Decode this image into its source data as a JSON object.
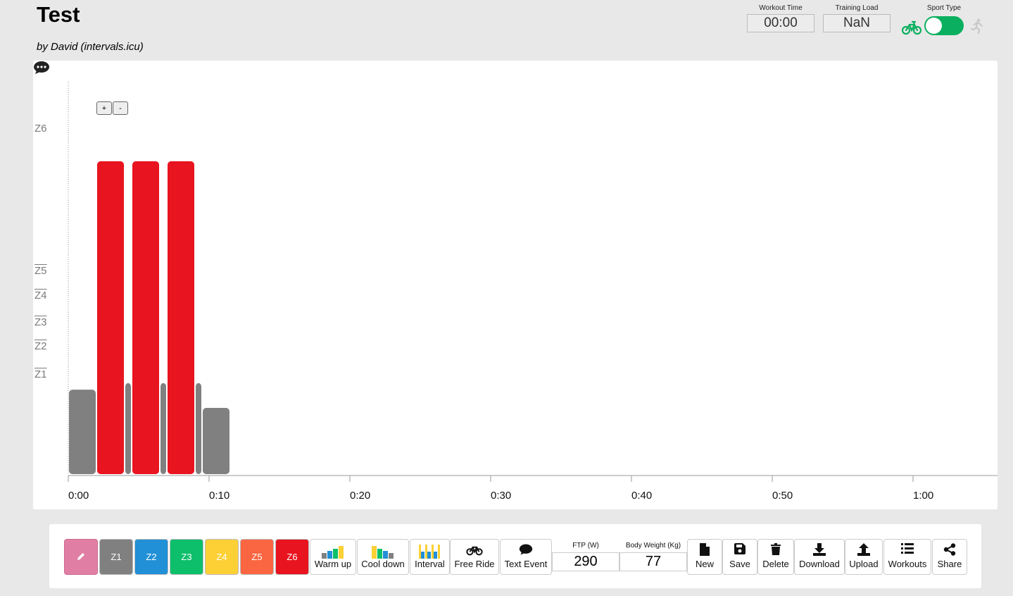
{
  "workout": {
    "title": "Test",
    "author": "by David (intervals.icu)"
  },
  "stats": {
    "workout_time_label": "Workout Time",
    "workout_time_value": "00:00",
    "training_load_label": "Training Load",
    "training_load_value": "NaN",
    "sport_type_label": "Sport Type",
    "sport_selected": "bike"
  },
  "chart": {
    "zoom_in_label": "+",
    "zoom_out_label": "-",
    "zone_labels": [
      "Z6",
      "Z5",
      "Z4",
      "Z3",
      "Z2",
      "Z1"
    ],
    "time_ticks": [
      "0:00",
      "0:10",
      "0:20",
      "0:30",
      "0:40",
      "0:50",
      "1:00"
    ]
  },
  "chart_data": {
    "type": "bar",
    "xlabel": "",
    "ylabel": "",
    "x_ticks": [
      "0:00",
      "0:10",
      "0:20",
      "0:30",
      "0:40",
      "0:50",
      "1:00"
    ],
    "x_range_minutes": [
      0,
      66
    ],
    "intervals": [
      {
        "start_min": 0.0,
        "end_min": 2.0,
        "zone": "Z1",
        "power_pct_ftp": 51,
        "color": "#808080"
      },
      {
        "start_min": 2.0,
        "end_min": 4.0,
        "zone": "Z6",
        "power_pct_ftp": 189,
        "color": "#e8141f"
      },
      {
        "start_min": 4.0,
        "end_min": 4.5,
        "zone": "Z1",
        "power_pct_ftp": 55,
        "color": "#808080"
      },
      {
        "start_min": 4.5,
        "end_min": 6.5,
        "zone": "Z6",
        "power_pct_ftp": 189,
        "color": "#e8141f"
      },
      {
        "start_min": 6.5,
        "end_min": 7.0,
        "zone": "Z1",
        "power_pct_ftp": 55,
        "color": "#808080"
      },
      {
        "start_min": 7.0,
        "end_min": 9.0,
        "zone": "Z6",
        "power_pct_ftp": 189,
        "color": "#e8141f"
      },
      {
        "start_min": 9.0,
        "end_min": 9.5,
        "zone": "Z1",
        "power_pct_ftp": 55,
        "color": "#808080"
      },
      {
        "start_min": 9.5,
        "end_min": 11.5,
        "zone": "Z1",
        "power_pct_ftp": 40,
        "color": "#808080"
      }
    ],
    "zone_markers_pct_ftp": [
      {
        "zone": "Z6",
        "pct": 185
      },
      {
        "zone": "Z5",
        "pct": 105
      },
      {
        "zone": "Z4",
        "pct": 95
      },
      {
        "zone": "Z3",
        "pct": 83
      },
      {
        "zone": "Z2",
        "pct": 75
      },
      {
        "zone": "Z1",
        "pct": 60
      }
    ]
  },
  "toolbar": {
    "edit_icon": "pencil-icon",
    "zones": [
      {
        "label": "Z1",
        "color": "#808080"
      },
      {
        "label": "Z2",
        "color": "#2190d6"
      },
      {
        "label": "Z3",
        "color": "#0dbf6b"
      },
      {
        "label": "Z4",
        "color": "#fdd035"
      },
      {
        "label": "Z5",
        "color": "#fb6642"
      },
      {
        "label": "Z6",
        "color": "#e8141f"
      }
    ],
    "warmup_label": "Warm up",
    "cooldown_label": "Cool down",
    "interval_label": "Interval",
    "freeride_label": "Free Ride",
    "textevent_label": "Text Event",
    "ftp_label": "FTP (W)",
    "ftp_value": "290",
    "weight_label": "Body Weight (Kg)",
    "weight_value": "77",
    "new_label": "New",
    "save_label": "Save",
    "delete_label": "Delete",
    "download_label": "Download",
    "upload_label": "Upload",
    "workouts_label": "Workouts",
    "share_label": "Share"
  }
}
